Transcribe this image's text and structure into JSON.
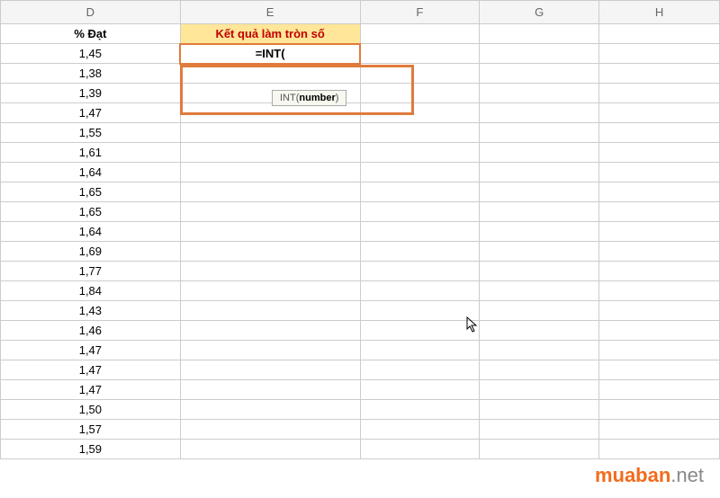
{
  "columns": [
    "D",
    "E",
    "F",
    "G",
    "H"
  ],
  "headers": {
    "d": "% Đạt",
    "e": "Kết quả làm tròn số"
  },
  "formula": "=INT(",
  "tooltip": {
    "prefix": "INT(",
    "arg": "number",
    "suffix": ")"
  },
  "data_d": [
    "1,45",
    "1,38",
    "1,39",
    "1,47",
    "1,55",
    "1,61",
    "1,64",
    "1,65",
    "1,65",
    "1,64",
    "1,69",
    "1,77",
    "1,84",
    "1,43",
    "1,46",
    "1,47",
    "1,47",
    "1,47",
    "1,50",
    "1,57",
    "1,59"
  ],
  "watermark": {
    "brand": "muaban",
    "ext": ".net"
  }
}
